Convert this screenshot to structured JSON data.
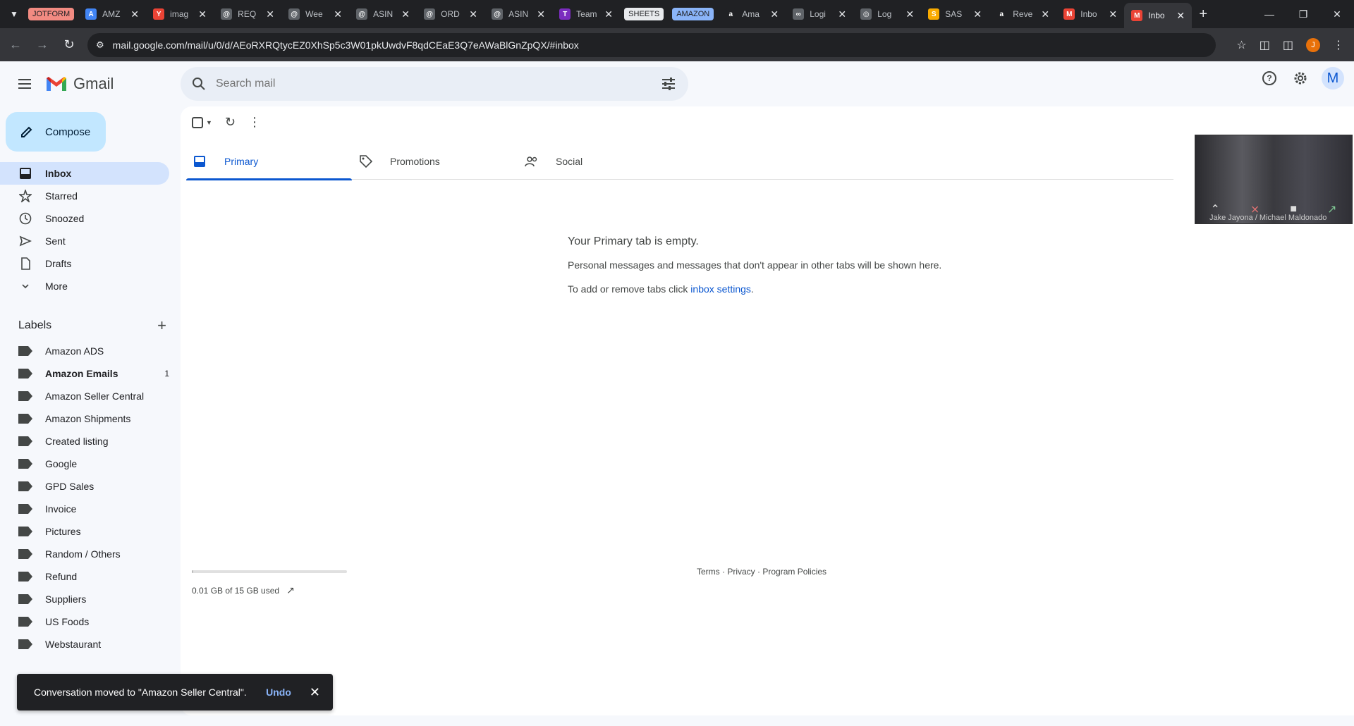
{
  "browser": {
    "tabs": [
      {
        "title": "JOTFORM",
        "kind": "chip",
        "bg": "#f28b82",
        "fg": "#202124"
      },
      {
        "title": "AMZ",
        "fav": "#4285f4",
        "favtxt": "A",
        "closable": true
      },
      {
        "title": "imag",
        "fav": "#ea4335",
        "favtxt": "Y",
        "closable": true
      },
      {
        "title": "REQ",
        "fav": "#5f6368",
        "favtxt": "@",
        "closable": true
      },
      {
        "title": "Wee",
        "fav": "#5f6368",
        "favtxt": "@",
        "closable": true
      },
      {
        "title": "ASIN",
        "fav": "#5f6368",
        "favtxt": "@",
        "closable": true
      },
      {
        "title": "ORD",
        "fav": "#5f6368",
        "favtxt": "@",
        "closable": true
      },
      {
        "title": "ASIN",
        "fav": "#5f6368",
        "favtxt": "@",
        "closable": true
      },
      {
        "title": "Team",
        "fav": "#7b2cbf",
        "favtxt": "T",
        "closable": true
      },
      {
        "title": "SHEETS",
        "kind": "chip",
        "bg": "#e8eaed",
        "fg": "#202124"
      },
      {
        "title": "AMAZON",
        "kind": "chip",
        "bg": "#8ab4f8",
        "fg": "#202124"
      },
      {
        "title": "Ama",
        "fav": "#202124",
        "favtxt": "a",
        "closable": true
      },
      {
        "title": "Logi",
        "fav": "#5f6368",
        "favtxt": "∞",
        "closable": true
      },
      {
        "title": "Log",
        "fav": "#5f6368",
        "favtxt": "◎",
        "closable": true
      },
      {
        "title": "SAS",
        "fav": "#f9ab00",
        "favtxt": "S",
        "closable": true
      },
      {
        "title": "Reve",
        "fav": "#202124",
        "favtxt": "a",
        "closable": true
      },
      {
        "title": "Inbo",
        "fav": "#ea4335",
        "favtxt": "M",
        "closable": true
      },
      {
        "title": "Inbo",
        "fav": "#ea4335",
        "favtxt": "M",
        "closable": true,
        "active": true
      }
    ],
    "url": "mail.google.com/mail/u/0/d/AEoRXRQtycEZ0XhSp5c3W01pkUwdvF8qdCEaE3Q7eAWaBlGnZpQX/#inbox",
    "profile_initial": "J"
  },
  "gmail": {
    "brand": "Gmail",
    "search_placeholder": "Search mail",
    "avatar_initial": "M",
    "compose_label": "Compose",
    "nav": [
      {
        "label": "Inbox",
        "icon": "inbox-icon",
        "active": true
      },
      {
        "label": "Starred",
        "icon": "star-icon"
      },
      {
        "label": "Snoozed",
        "icon": "clock-icon"
      },
      {
        "label": "Sent",
        "icon": "send-icon"
      },
      {
        "label": "Drafts",
        "icon": "draft-icon"
      },
      {
        "label": "More",
        "icon": "chevron-down-icon"
      }
    ],
    "labels_title": "Labels",
    "labels": [
      {
        "label": "Amazon ADS"
      },
      {
        "label": "Amazon Emails",
        "bold": true,
        "count": "1"
      },
      {
        "label": "Amazon Seller Central"
      },
      {
        "label": "Amazon Shipments"
      },
      {
        "label": "Created listing"
      },
      {
        "label": "Google"
      },
      {
        "label": "GPD Sales"
      },
      {
        "label": "Invoice"
      },
      {
        "label": "Pictures"
      },
      {
        "label": "Random / Others"
      },
      {
        "label": "Refund"
      },
      {
        "label": "Suppliers"
      },
      {
        "label": "US Foods"
      },
      {
        "label": "Webstaurant"
      }
    ],
    "inbox_tabs": [
      {
        "label": "Primary",
        "icon": "inbox-icon",
        "active": true
      },
      {
        "label": "Promotions",
        "icon": "tag-icon"
      },
      {
        "label": "Social",
        "icon": "people-icon"
      }
    ],
    "empty": {
      "title": "Your Primary tab is empty.",
      "line1": "Personal messages and messages that don't appear in other tabs will be shown here.",
      "line2_prefix": "To add or remove tabs click ",
      "line2_link": "inbox settings",
      "line2_suffix": "."
    },
    "storage": {
      "text": "0.01 GB of 15 GB used",
      "fraction": 0.001
    },
    "footer": {
      "terms": "Terms",
      "privacy": "Privacy",
      "policies": "Program Policies",
      "sep": " · "
    },
    "video": {
      "names": "Jake Jayona / Michael Maldonado"
    },
    "snackbar": {
      "message": "Conversation moved to \"Amazon Seller Central\".",
      "undo": "Undo"
    }
  }
}
